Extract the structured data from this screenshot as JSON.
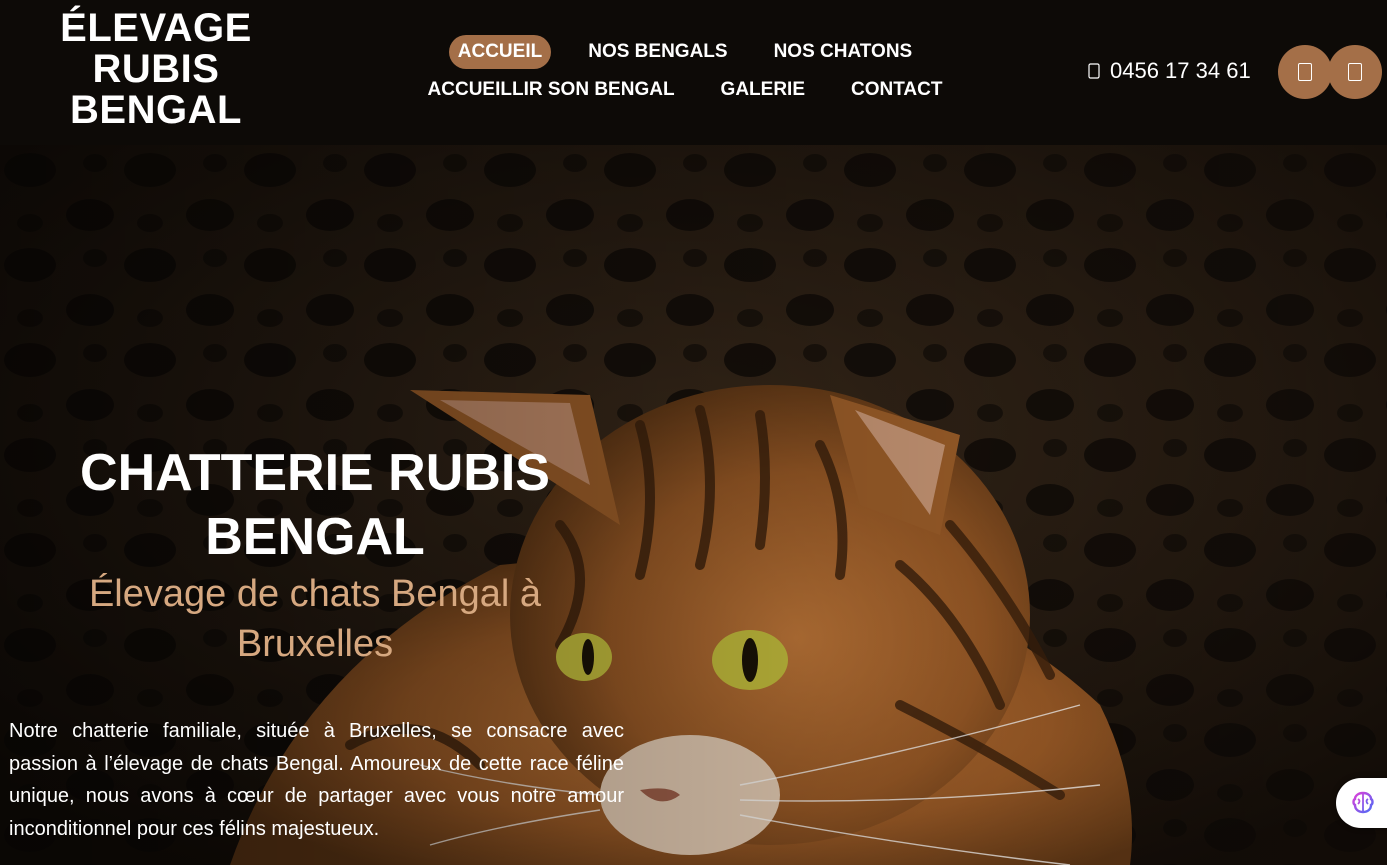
{
  "header": {
    "logo_lines": [
      "ÉLEVAGE",
      "RUBIS",
      "BENGAL"
    ],
    "nav_row1": [
      "ACCUEIL",
      "NOS BENGALS",
      "NOS CHATONS"
    ],
    "nav_row2": [
      "ACCUEILLIR SON BENGAL",
      "GALERIE",
      "CONTACT"
    ],
    "active_item": "ACCUEIL",
    "phone": "0456 17 34 61",
    "phone_icon": "phone-icon",
    "action_icons": [
      "facebook-icon",
      "instagram-icon"
    ]
  },
  "hero": {
    "title_line1": "CHATTERIE RUBIS",
    "title_line2": "BENGAL",
    "subtitle_line1": "Élevage de chats Bengal à",
    "subtitle_line2": "Bruxelles",
    "paragraph": "Notre chatterie familiale, située à Bruxelles, se consacre avec passion à l’élevage de chats Bengal. Amoureux de cette race féline unique, nous avons à cœur de partager avec vous notre amour inconditionnel pour ces félins majestueux.",
    "background_image": "bengal-cat-photo"
  },
  "floating": {
    "icon": "ai-brain-icon"
  },
  "colors": {
    "header_bg": "#0d0a07",
    "accent": "#a46f48",
    "subtitle": "#d6a880",
    "text": "#ffffff"
  }
}
